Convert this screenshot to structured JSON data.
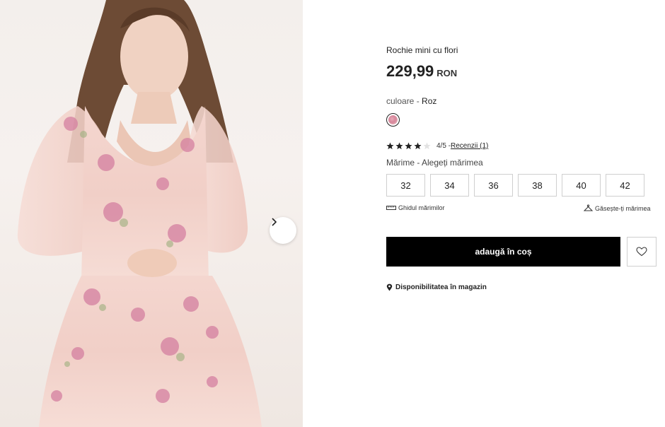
{
  "product": {
    "name": "Rochie mini cu flori",
    "price": "229,99",
    "currency": "RON",
    "color_label": "culoare - ",
    "color_value": "Roz",
    "swatch_color": "#e2a3b2"
  },
  "rating": {
    "stars": 4,
    "max": 5,
    "score_text": "4/5 - ",
    "reviews_link": "Recenzii (1)"
  },
  "size": {
    "label": "Mărime - Alegeți mărimea",
    "options": [
      "32",
      "34",
      "36",
      "38",
      "40",
      "42"
    ],
    "guide_label": "Ghidul mărimilor",
    "finder_label": "Găsește-ți mărimea"
  },
  "actions": {
    "add_to_cart": "adaugă în coș",
    "store_availability": "Disponibilitatea în magazin"
  },
  "icons": {
    "next": "chevron-right-icon",
    "wishlist": "heart-icon",
    "ruler": "ruler-icon",
    "hanger": "hanger-icon",
    "location": "location-pin-icon",
    "star": "star-icon"
  },
  "colors": {
    "primary_button": "#000000",
    "border": "#cfcfcf",
    "dress_pink": "#f1d2cb",
    "flower": "#d17a98"
  }
}
